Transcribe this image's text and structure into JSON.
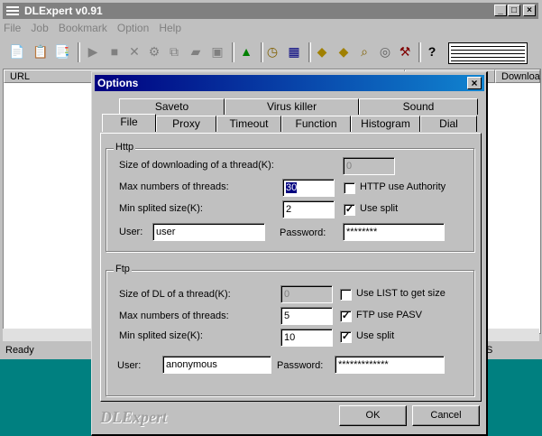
{
  "app": {
    "title": "DLExpert v0.91",
    "menu": [
      "File",
      "Job",
      "Bookmark",
      "Option",
      "Help"
    ],
    "columns": [
      "URL",
      "Downloa"
    ],
    "status": "Ready",
    "status_right": "S",
    "toolbar_icons": [
      "new-icon",
      "open-icon",
      "copy-icon",
      "play-icon",
      "stop-icon",
      "delete-icon",
      "properties-icon",
      "clipboard-icon",
      "folder-icon",
      "save-icon",
      "move-icon",
      "timer-icon",
      "monitor-icon",
      "package-icon",
      "package2-icon",
      "search-icon",
      "settings-icon",
      "tools-icon",
      "help-icon"
    ]
  },
  "dialog": {
    "title": "Options",
    "tabs_row1": [
      "Saveto",
      "Virus killer",
      "Sound"
    ],
    "tabs_row2": [
      "File",
      "Proxy",
      "Timeout",
      "Function",
      "Histogram",
      "Dial"
    ],
    "selected_tab": "File",
    "http": {
      "group": "Http",
      "size_label": "Size of downloading of a thread(K):",
      "size_value": "0",
      "max_label": "Max numbers of threads:",
      "max_value": "30",
      "min_label": "Min splited size(K):",
      "min_value": "2",
      "user_label": "User:",
      "user_value": "user",
      "password_label": "Password:",
      "password_value": "********",
      "authority_label": "HTTP use Authority",
      "authority_checked": false,
      "split_label": "Use split",
      "split_checked": true
    },
    "ftp": {
      "group": "Ftp",
      "size_label": "Size of DL of a thread(K):",
      "size_value": "0",
      "max_label": "Max numbers of threads:",
      "max_value": "5",
      "min_label": "Min splited size(K):",
      "min_value": "10",
      "user_label": "User:",
      "user_value": "anonymous",
      "password_label": "Password:",
      "password_value": "*************",
      "list_label": "Use LIST to get size",
      "list_checked": false,
      "pasv_label": "FTP use PASV",
      "pasv_checked": true,
      "split_label": "Use split",
      "split_checked": true
    },
    "brand": "DLExpert",
    "ok": "OK",
    "cancel": "Cancel"
  }
}
